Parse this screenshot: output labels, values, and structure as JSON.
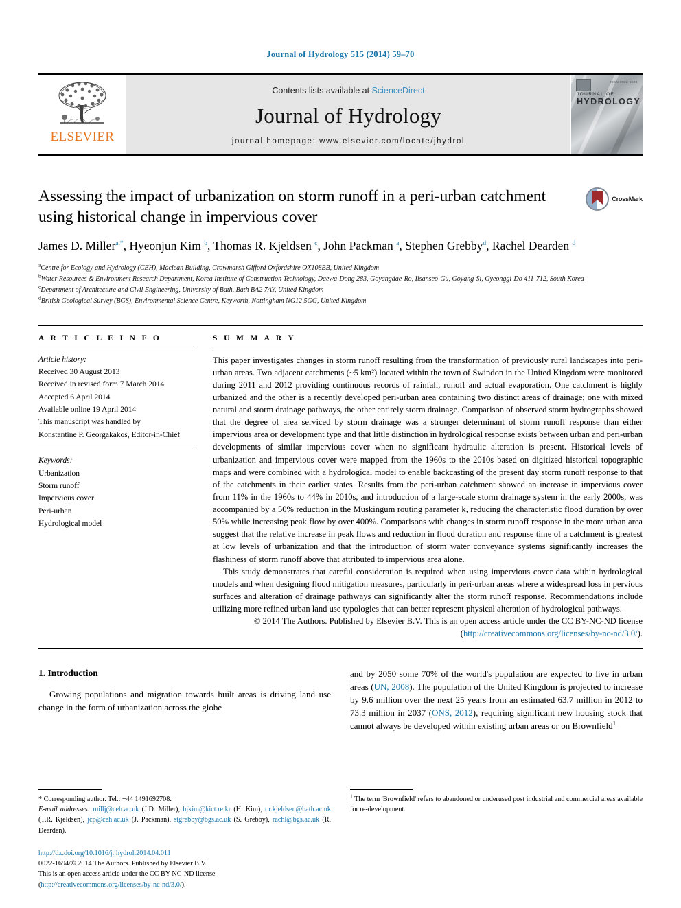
{
  "running_head": "Journal of Hydrology 515 (2014) 59–70",
  "masthead": {
    "publisher": "ELSEVIER",
    "contents_prefix": "Contents lists available at ",
    "contents_link": "ScienceDirect",
    "journal_name": "Journal of Hydrology",
    "homepage": "journal homepage: www.elsevier.com/locate/jhydrol",
    "cover": {
      "line1": "JOURNAL OF",
      "line2": "HYDROLOGY",
      "code": "ISSN 0022-1694"
    }
  },
  "article": {
    "title": "Assessing the impact of urbanization on storm runoff in a peri-urban catchment using historical change in impervious cover",
    "crossmark_label": "CrossMark",
    "authors_html": "James D. Miller<sup>a,*</sup>, Hyeonjun Kim <sup>b</sup>, Thomas R. Kjeldsen <sup>c</sup>, John Packman <sup>a</sup>, Stephen Grebby<sup>d</sup>, Rachel Dearden <sup>d</sup>",
    "affiliations": [
      {
        "marker": "a",
        "text": "Centre for Ecology and Hydrology (CEH), Maclean Building, Crowmarsh Gifford Oxfordshire OX108BB, United Kingdom"
      },
      {
        "marker": "b",
        "text": "Water Resources & Environment Research Department, Korea Institute of Construction Technology, Daewa-Dong 283, Goyangdae-Ro, Ilsanseo-Gu, Goyang-Si, Gyeonggi-Do 411-712, South Korea"
      },
      {
        "marker": "c",
        "text": "Department of Architecture and Civil Engineering, University of Bath, Bath BA2 7AY, United Kingdom"
      },
      {
        "marker": "d",
        "text": "British Geological Survey (BGS), Environmental Science Centre, Keyworth, Nottingham NG12 5GG, United Kingdom"
      }
    ]
  },
  "article_info": {
    "heading": "A R T I C L E  I N F O",
    "history_label": "Article history:",
    "history": [
      "Received 30 August 2013",
      "Received in revised form 7 March 2014",
      "Accepted 6 April 2014",
      "Available online 19 April 2014",
      "This manuscript was handled by",
      "Konstantine P. Georgakakos, Editor-in-Chief"
    ],
    "keywords_label": "Keywords:",
    "keywords": [
      "Urbanization",
      "Storm runoff",
      "Impervious cover",
      "Peri-urban",
      "Hydrological model"
    ]
  },
  "summary": {
    "heading": "S U M M A R Y",
    "paragraph1": "This paper investigates changes in storm runoff resulting from the transformation of previously rural landscapes into peri-urban areas. Two adjacent catchments (~5 km²) located within the town of Swindon in the United Kingdom were monitored during 2011 and 2012 providing continuous records of rainfall, runoff and actual evaporation. One catchment is highly urbanized and the other is a recently developed peri-urban area containing two distinct areas of drainage; one with mixed natural and storm drainage pathways, the other entirely storm drainage. Comparison of observed storm hydrographs showed that the degree of area serviced by storm drainage was a stronger determinant of storm runoff response than either impervious area or development type and that little distinction in hydrological response exists between urban and peri-urban developments of similar impervious cover when no significant hydraulic alteration is present. Historical levels of urbanization and impervious cover were mapped from the 1960s to the 2010s based on digitized historical topographic maps and were combined with a hydrological model to enable backcasting of the present day storm runoff response to that of the catchments in their earlier states. Results from the peri-urban catchment showed an increase in impervious cover from 11% in the 1960s to 44% in 2010s, and introduction of a large-scale storm drainage system in the early 2000s, was accompanied by a 50% reduction in the Muskingum routing parameter k, reducing the characteristic flood duration by over 50% while increasing peak flow by over 400%. Comparisons with changes in storm runoff response in the more urban area suggest that the relative increase in peak flows and reduction in flood duration and response time of a catchment is greatest at low levels of urbanization and that the introduction of storm water conveyance systems significantly increases the flashiness of storm runoff above that attributed to impervious area alone.",
    "paragraph2": "This study demonstrates that careful consideration is required when using impervious cover data within hydrological models and when designing flood mitigation measures, particularly in peri-urban areas where a widespread loss in pervious surfaces and alteration of drainage pathways can significantly alter the storm runoff response. Recommendations include utilizing more refined urban land use typologies that can better represent physical alteration of hydrological pathways.",
    "copyright_prefix": "© 2014 The Authors. Published by Elsevier B.V. This is an open access article under the CC BY-NC-ND license (",
    "copyright_link": "http://creativecommons.org/licenses/by-nc-nd/3.0/",
    "copyright_suffix": ")."
  },
  "introduction": {
    "heading": "1. Introduction",
    "left_paragraph": "Growing populations and migration towards built areas is driving land use change in the form of urbanization across the globe",
    "right_paragraph_part1": "and by 2050 some 70% of the world's population are expected to live in urban areas (",
    "ref_un": "UN, 2008",
    "right_paragraph_part2": "). The population of the United Kingdom is projected to increase by 9.6 million over the next 25 years from an estimated 63.7 million in 2012 to 73.3 million in 2037 (",
    "ref_ons": "ONS, 2012",
    "right_paragraph_part3": "), requiring significant new housing stock that cannot always be developed within existing urban areas or on Brownfield"
  },
  "footnotes": {
    "corresponding": "Corresponding author. Tel.: +44 1491692708.",
    "email_label": "E-mail addresses:",
    "emails": [
      {
        "address": "millj@ceh.ac.uk",
        "name": "(J.D. Miller)"
      },
      {
        "address": "hjkim@kict.re.kr",
        "name": "(H. Kim)"
      },
      {
        "address": "t.r.kjeldsen@bath.ac.uk",
        "name": "(T.R. Kjeldsen)"
      },
      {
        "address": "jcp@ceh.ac.uk",
        "name": "(J. Packman)"
      },
      {
        "address": "stgrebby@bgs.ac.uk",
        "name": "(S. Grebby)"
      },
      {
        "address": "rachl@bgs.ac.uk",
        "name": "(R. Dearden)"
      }
    ],
    "brownfield_note": "The term 'Brownfield' refers to abandoned or underused post industrial and commercial areas available for re-development.",
    "brownfield_marker": "1"
  },
  "publication": {
    "doi": "http://dx.doi.org/10.1016/j.jhydrol.2014.04.011",
    "issn_line": "0022-1694/© 2014 The Authors. Published by Elsevier B.V.",
    "license_prefix": "This is an open access article under the CC BY-NC-ND license (",
    "license_link": "http://creativecommons.org/licenses/by-nc-nd/3.0/",
    "license_suffix": ")."
  },
  "colors": {
    "link": "#1574a8",
    "elsevier_orange": "#e87722",
    "sciencedirect": "#3a8fc4",
    "band_gray": "#e6e6e6"
  }
}
